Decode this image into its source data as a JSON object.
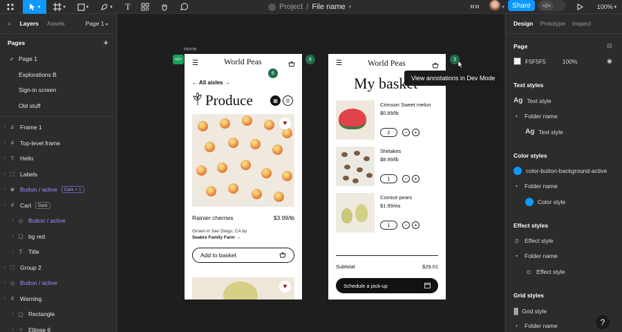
{
  "toolbar": {
    "project": "Project",
    "separator": "/",
    "file_name": "File name",
    "share_label": "Share",
    "dev_mode_icon": "</>",
    "zoom": "100%"
  },
  "left_panel": {
    "tabs": {
      "layers": "Layers",
      "assets": "Assets"
    },
    "page_selector": "Page 1",
    "pages_title": "Pages",
    "pages": [
      "Page 1",
      "Explorations B",
      "Sign-in screen",
      "Old stuff"
    ],
    "layers": [
      {
        "label": "Frame 1",
        "icon": "#",
        "level": 0
      },
      {
        "label": "Top-level frame",
        "icon": "#",
        "level": 0
      },
      {
        "label": "Hello",
        "icon": "T",
        "level": 0
      },
      {
        "label": "Labels",
        "icon": "⬚",
        "level": 0
      },
      {
        "label": "Button / active",
        "icon": "❖",
        "level": 0,
        "purple": true,
        "badge": "Dark + 1"
      },
      {
        "label": "Cart",
        "icon": "#",
        "level": 0,
        "badge": "Dark",
        "badge_grey": true
      },
      {
        "label": "Button / active",
        "icon": "◇",
        "level": 1,
        "purple": true
      },
      {
        "label": "bg red",
        "icon": "▢",
        "level": 1
      },
      {
        "label": "Title",
        "icon": "T",
        "level": 1
      },
      {
        "label": "Group 2",
        "icon": "⬚",
        "level": 0
      },
      {
        "label": "Button / active",
        "icon": "◇",
        "level": 0,
        "purple": true
      },
      {
        "label": "Warning",
        "icon": "#",
        "level": 0
      },
      {
        "label": "Rectangle",
        "icon": "▢",
        "level": 1
      },
      {
        "label": "Ellipse 6",
        "icon": "○",
        "level": 1
      }
    ]
  },
  "canvas": {
    "frame1_label": "Home",
    "dev_tag": "</>",
    "badge_six": "6",
    "badge_three": "3",
    "tooltip": "View annotations in Dev Mode",
    "home": {
      "brand": "World Peas",
      "back_link": "← All aisles →",
      "heading": "Produce",
      "product_name": "Rainier cherries",
      "product_price": "$3.99/lb",
      "origin_line": "Grown in San Diego, CA by",
      "farm_link": "Seabre Family Farm →",
      "add_button": "Add to basket"
    },
    "basket": {
      "brand": "World Peas",
      "heading": "My basket",
      "items": [
        {
          "name": "Crimson Sweet melon",
          "price": "$0.89/lb",
          "qty": "2"
        },
        {
          "name": "Shiitakes",
          "price": "$8.99/lb",
          "qty": "1"
        },
        {
          "name": "Comice pears",
          "price": "$1.99/ea",
          "qty": "1"
        }
      ],
      "subtotal_label": "Subtotal",
      "subtotal_value": "$29.01",
      "pickup_button": "Schedule a pick-up"
    }
  },
  "right_panel": {
    "tabs": {
      "design": "Design",
      "prototype": "Prototype",
      "inspect": "Inspect"
    },
    "page_title": "Page",
    "page_color": "F5F5F5",
    "page_opacity": "100%",
    "text_styles_title": "Text styles",
    "text_style": "Text style",
    "folder_name": "Folder name",
    "color_styles_title": "Color styles",
    "color_style_name": "color-button-background-active",
    "color_style": "Color style",
    "effect_styles_title": "Effect styles",
    "effect_style": "Effect style",
    "grid_styles_title": "Grid styles",
    "grid_style": "Grid style",
    "accent": "#0d99ff"
  }
}
